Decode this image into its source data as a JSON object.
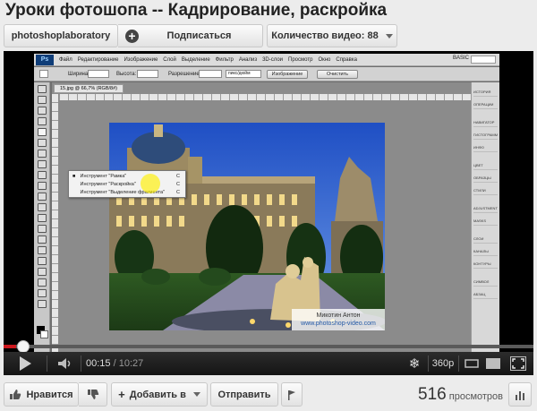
{
  "title": "Уроки фотошопа -- Кадрирование, раскройка",
  "channel": {
    "name": "photoshoplaboratory",
    "subscribe_label": "Подписаться",
    "videos_label": "Количество видео: 88"
  },
  "screencast": {
    "menu": [
      "Файл",
      "Редактирование",
      "Изображение",
      "Слой",
      "Выделение",
      "Фильтр",
      "Анализ",
      "3D-слои",
      "Просмотр",
      "Окно",
      "Справка"
    ],
    "logo": "Ps",
    "workspace": "BASIC",
    "options": {
      "width_label": "Ширина:",
      "height_label": "Высота:",
      "resolution_label": "Разрешение:",
      "units": "пикс/дюйм",
      "image_button": "Изображение",
      "clear_button": "Очистить"
    },
    "doc_tab": "15.jpg @ 66,7% (RGB/8#)",
    "flyout": [
      {
        "label": "Инструмент \"Рамка\"",
        "shortcut": "C",
        "active": true
      },
      {
        "label": "Инструмент \"Раскройка\"",
        "shortcut": "C",
        "active": false
      },
      {
        "label": "Инструмент \"Выделение фрагмента\"",
        "shortcut": "C",
        "active": false
      }
    ],
    "panels": [
      "ИСТОРИЯ",
      "ОПЕРАЦИИ",
      "НАВИГАТОР",
      "ГИСТОГРАММА",
      "ИНФО",
      "ЦВЕТ",
      "ОБРАЗЦЫ",
      "СТИЛИ",
      "ADJUSTMENTS",
      "MASKS",
      "СЛОИ",
      "КАНАЛЫ",
      "КОНТУРЫ",
      "СИМВОЛ",
      "АБЗАЦ"
    ],
    "watermark_name": "Микотин Антон",
    "watermark_url": "www.photoshop-video.com"
  },
  "player": {
    "current_time": "00:15",
    "total_time": "/ 10:27",
    "quality": "360p",
    "progress": 0.024
  },
  "actions": {
    "like_label": "Нравится",
    "add_label": "Добавить в",
    "share_label": "Отправить"
  },
  "views": {
    "count": "516",
    "label": "просмотров"
  },
  "colors": {
    "progress": "#cc181e",
    "sky": "#3b6fd6"
  }
}
